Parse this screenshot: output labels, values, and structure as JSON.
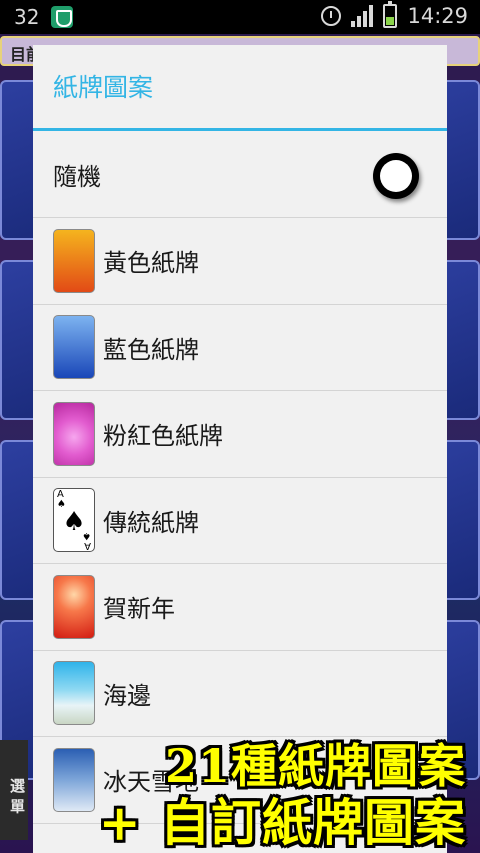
{
  "status_bar": {
    "notification_count": "32",
    "time": "14:29",
    "icons": [
      "shield-app-icon",
      "alarm-icon",
      "signal-icon",
      "battery-icon"
    ]
  },
  "background_app": {
    "top_label": "目前…",
    "side_label": "選 單"
  },
  "dialog": {
    "title": "紙牌圖案",
    "accent_color": "#33b5e5",
    "options": [
      {
        "label": "隨機",
        "selected": true
      },
      {
        "label": "黃色紙牌",
        "thumb": "yellow-card",
        "colors": [
          "#f5b41e",
          "#e24a16"
        ]
      },
      {
        "label": "藍色紙牌",
        "thumb": "blue-card",
        "colors": [
          "#7db3f0",
          "#1a47b8"
        ]
      },
      {
        "label": "粉紅色紙牌",
        "thumb": "pink-card",
        "colors": [
          "#f27ae0",
          "#b7289f"
        ]
      },
      {
        "label": "傳統紙牌",
        "thumb": "classic-spade-card",
        "colors": [
          "#ffffff",
          "#ffffff"
        ]
      },
      {
        "label": "賀新年",
        "thumb": "new-year-card",
        "colors": [
          "#f7784a",
          "#d21c12"
        ]
      },
      {
        "label": "海邊",
        "thumb": "beach-card",
        "colors": [
          "#2fb3ea",
          "#e8f4f7"
        ]
      },
      {
        "label": "冰天雪地",
        "thumb": "snow-card",
        "colors": [
          "#2b5fb3",
          "#dfe9f5"
        ]
      }
    ]
  },
  "promo": {
    "line1": "21種紙牌圖案",
    "line2": "+ 自訂紙牌圖案"
  }
}
